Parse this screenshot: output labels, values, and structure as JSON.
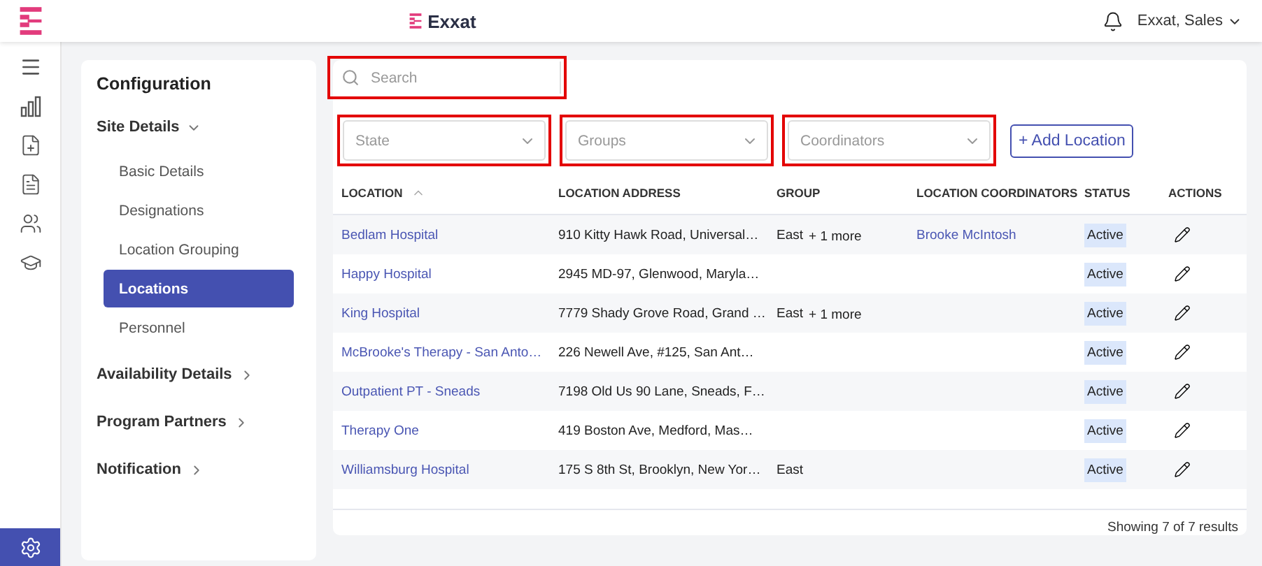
{
  "header": {
    "brand": "Exxat",
    "user": "Exxat, Sales"
  },
  "rail": [
    {
      "kind": "menu",
      "selected": false
    },
    {
      "kind": "chart",
      "selected": false
    },
    {
      "kind": "file-plus",
      "selected": false
    },
    {
      "kind": "file-text",
      "selected": false
    },
    {
      "kind": "users",
      "selected": false
    },
    {
      "kind": "cap",
      "selected": false
    },
    {
      "kind": "settings",
      "selected": true
    }
  ],
  "config": {
    "title": "Configuration",
    "sections": [
      {
        "label": "Site Details",
        "expanded": true,
        "children": [
          {
            "label": "Basic Details",
            "selected": false
          },
          {
            "label": "Designations",
            "selected": false
          },
          {
            "label": "Location Grouping",
            "selected": false
          },
          {
            "label": "Locations",
            "selected": true
          },
          {
            "label": "Personnel",
            "selected": false
          }
        ]
      },
      {
        "label": "Availability Details",
        "expanded": false
      },
      {
        "label": "Program Partners",
        "expanded": false
      },
      {
        "label": "Notification",
        "expanded": false
      }
    ]
  },
  "search": {
    "placeholder": "Search",
    "highlighted": true
  },
  "filters": [
    {
      "placeholder": "State",
      "highlighted": true
    },
    {
      "placeholder": "Groups",
      "highlighted": true
    },
    {
      "placeholder": "Coordinators",
      "highlighted": true
    }
  ],
  "add_button": "+ Add Location",
  "table": {
    "columns": [
      "LOCATION",
      "LOCATION ADDRESS",
      "GROUP",
      "LOCATION COORDINATORS",
      "STATUS",
      "ACTIONS"
    ],
    "rows": [
      {
        "location": "Bedlam Hospital",
        "address": "910 Kitty Hawk Road, Universal…",
        "group": "East",
        "more": "+ 1 more",
        "coordinator": "Brooke McIntosh",
        "status": "Active"
      },
      {
        "location": "Happy Hospital",
        "address": "2945 MD-97, Glenwood, Maryla…",
        "status": "Active"
      },
      {
        "location": "King Hospital",
        "address": "7779 Shady Grove Road, Grand …",
        "group": "East",
        "more": "+ 1 more",
        "status": "Active"
      },
      {
        "location": "McBrooke's Therapy - San Anto…",
        "address": "226 Newell Ave, #125, San Ant…",
        "status": "Active"
      },
      {
        "location": "Outpatient PT - Sneads",
        "address": "7198 Old Us 90 Lane, Sneads, F…",
        "status": "Active"
      },
      {
        "location": "Therapy One",
        "address": "419 Boston Ave, Medford, Mas…",
        "status": "Active"
      },
      {
        "location": "Williamsburg Hospital",
        "address": "175 S 8th St, Brooklyn, New Yor…",
        "group": "East",
        "status": "Active"
      }
    ]
  },
  "footer": "Showing 7 of 7 results"
}
